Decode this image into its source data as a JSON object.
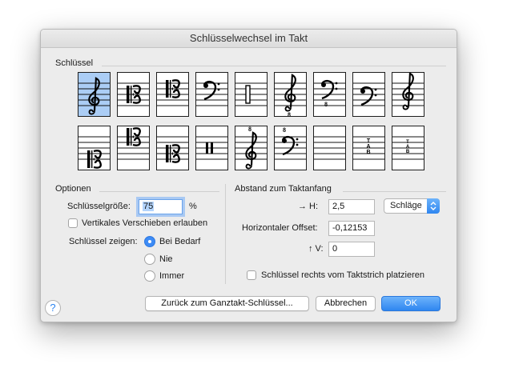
{
  "dialog": {
    "title": "Schlüsselwechsel im Takt"
  },
  "clefs": {
    "label": "Schlüssel",
    "items": [
      {
        "icon": "treble-clef-icon"
      },
      {
        "icon": "alto-clef-icon"
      },
      {
        "icon": "tenor-clef-icon"
      },
      {
        "icon": "bass-clef-icon"
      },
      {
        "icon": "percussion-clef-icon"
      },
      {
        "icon": "treble-8vb-clef-icon"
      },
      {
        "icon": "bass-8vb-clef-icon"
      },
      {
        "icon": "low-bass-clef-icon"
      },
      {
        "icon": "high-treble-clef-icon"
      },
      {
        "icon": "soprano-clef-icon"
      },
      {
        "icon": "baritone-c-clef-icon"
      },
      {
        "icon": "low-c-clef-icon"
      },
      {
        "icon": "neutral-percussion-clef-icon"
      },
      {
        "icon": "treble-8va-clef-icon"
      },
      {
        "icon": "bass-8va-clef-icon"
      },
      {
        "icon": "empty-clef-icon"
      },
      {
        "icon": "tab-clef-icon",
        "text": "TAB"
      },
      {
        "icon": "small-tab-clef-icon",
        "text": "TAB"
      }
    ],
    "selected_index": 0
  },
  "options": {
    "label": "Optionen",
    "size_label": "Schlüsselgröße:",
    "size_value": "75",
    "size_unit": "%",
    "vertical_shift_label": "Vertikales Verschieben erlauben",
    "vertical_shift_checked": false,
    "show_label": "Schlüssel zeigen:",
    "show_options": [
      "Bei Bedarf",
      "Nie",
      "Immer"
    ],
    "show_selected": 0
  },
  "offset": {
    "label": "Abstand zum Taktanfang",
    "h_label": "→ H:",
    "h_value": "2,5",
    "unit_value": "Schläge",
    "horizontal_label": "Horizontaler Offset:",
    "horizontal_value": "-0,12153",
    "v_label": "↑ V:",
    "v_value": "0",
    "right_of_barline_label": "Schlüssel rechts vom Taktstrich platzieren",
    "right_of_barline_checked": false
  },
  "buttons": {
    "help": "?",
    "reset": "Zurück zum Ganztakt-Schlüssel...",
    "cancel": "Abbrechen",
    "ok": "OK"
  },
  "colors": {
    "accent": "#2f86f0",
    "selection": "#abcdf5"
  }
}
